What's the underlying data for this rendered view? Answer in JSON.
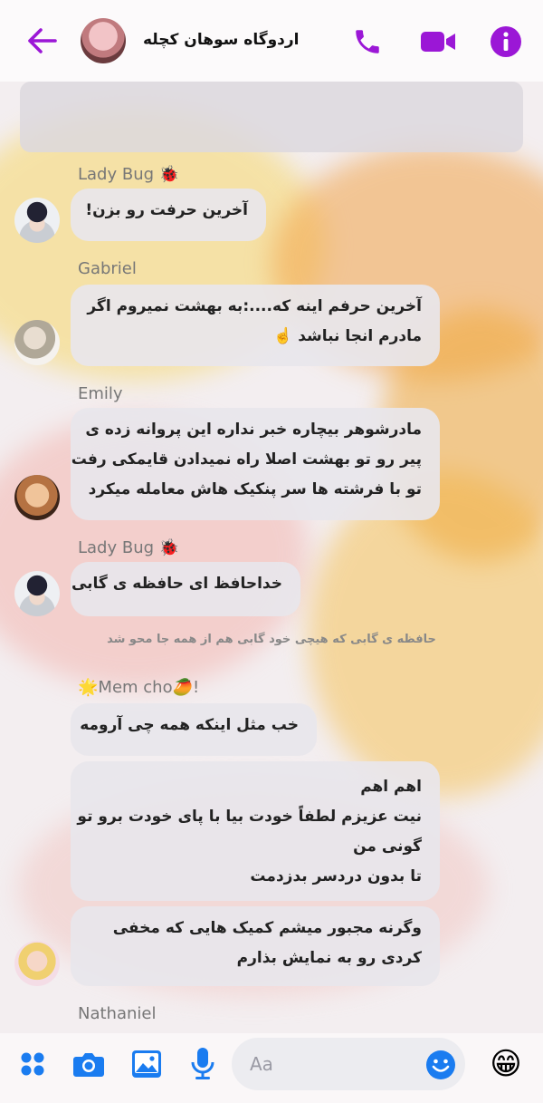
{
  "header": {
    "title": "اردوگاه سوهان کچله"
  },
  "messages": [
    {
      "sender": "Lady Bug 🐞",
      "lines": [
        "آخرین حرفت رو بزن!"
      ]
    },
    {
      "sender": "Gabriel",
      "lines": [
        "آخرین حرفم اینه که....:به بهشت نمیروم اگر",
        "مادرم انجا نباشد ☝️"
      ]
    },
    {
      "sender": "Emily",
      "lines": [
        "مادرشوهر بیچاره خبر نداره این پروانه زده ی",
        "پیر رو تو بهشت اصلا راه نمیدادن قایمکی رفت",
        "تو با فرشته ها سر پنکیک هاش معامله میکرد"
      ]
    },
    {
      "sender": "Lady Bug 🐞",
      "lines": [
        "خداحافظ ای حافظه ی گابی"
      ]
    },
    {
      "system": "حافظه ی گابی که هیچی خود گابی هم از همه جا محو شد"
    },
    {
      "sender": "🌟Mem cho🥭!",
      "lines": [
        "خب مثل اینکه همه چی آرومه"
      ]
    },
    {
      "lines": [
        "اهم اهم",
        "نیت عزیزم لطفاً خودت بیا با پای خودت برو تو",
        "گونی من",
        "تا بدون دردسر بدزدمت"
      ]
    },
    {
      "lines": [
        "وگرنه مجبور میشم کمیک هایی که مخفی",
        "کردی  رو به نمایش بذارم"
      ]
    },
    {
      "sender": "Nathaniel"
    }
  ],
  "composer": {
    "placeholder": "Aa",
    "reaction_emoji": "😁"
  },
  "icons": {
    "back": "back-arrow-icon",
    "call": "phone-icon",
    "video": "video-camera-icon",
    "info": "info-icon",
    "more": "apps-grid-icon",
    "camera": "camera-icon",
    "gallery": "image-icon",
    "mic": "microphone-icon",
    "emoji": "emoji-icon"
  },
  "colors": {
    "accent_purple": "#9b17d6",
    "accent_blue": "#1a7cf0"
  }
}
